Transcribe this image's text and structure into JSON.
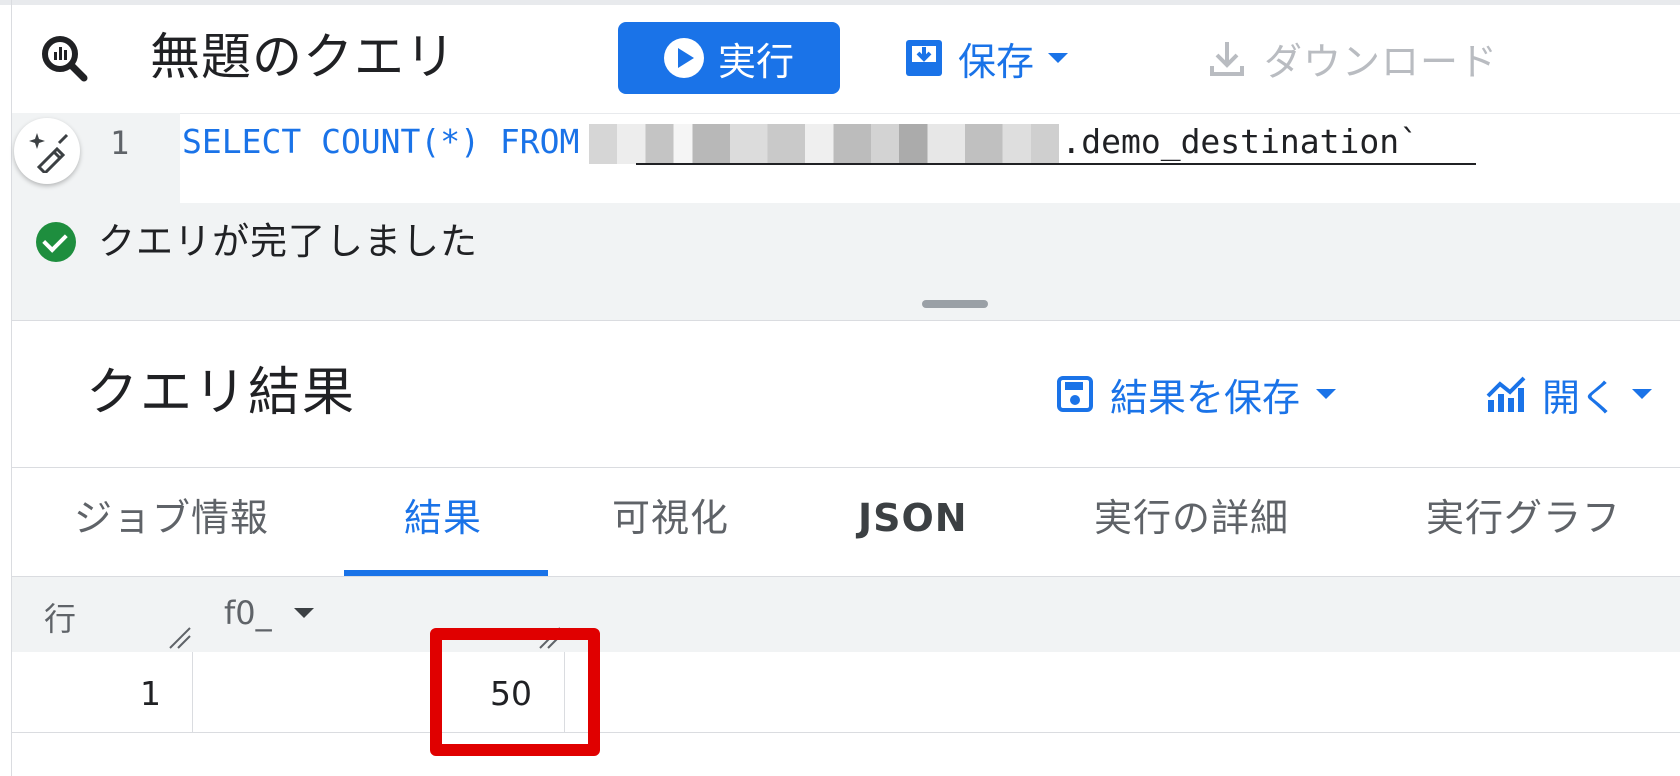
{
  "toolbar": {
    "query_title": "無題のクエリ",
    "run_label": "実行",
    "save_label": "保存",
    "download_label": "ダウンロード"
  },
  "editor": {
    "line_number": "1",
    "sql_keyword": "SELECT COUNT(*) FROM",
    "sql_table": ".demo_destination`"
  },
  "status": {
    "message": "クエリが完了しました"
  },
  "results": {
    "title": "クエリ結果",
    "save_results_label": "結果を保存",
    "open_label": "開く",
    "tabs": [
      {
        "label": "ジョブ情報"
      },
      {
        "label": "結果"
      },
      {
        "label": "可視化"
      },
      {
        "label": "JSON"
      },
      {
        "label": "実行の詳細"
      },
      {
        "label": "実行グラフ"
      }
    ],
    "active_tab": "結果",
    "table": {
      "columns": [
        "行",
        "f0_"
      ],
      "rows": [
        {
          "row": "1",
          "f0_": "50"
        }
      ]
    }
  },
  "colors": {
    "accent": "#1a73e8",
    "success": "#1e8e3e",
    "highlight": "#e00000"
  },
  "icons": [
    "bigquery-icon",
    "play-icon",
    "save-icon",
    "download-icon",
    "ai-assist-icon",
    "check-circle-icon",
    "floppy-icon",
    "chart-icon",
    "chevron-down-icon"
  ]
}
